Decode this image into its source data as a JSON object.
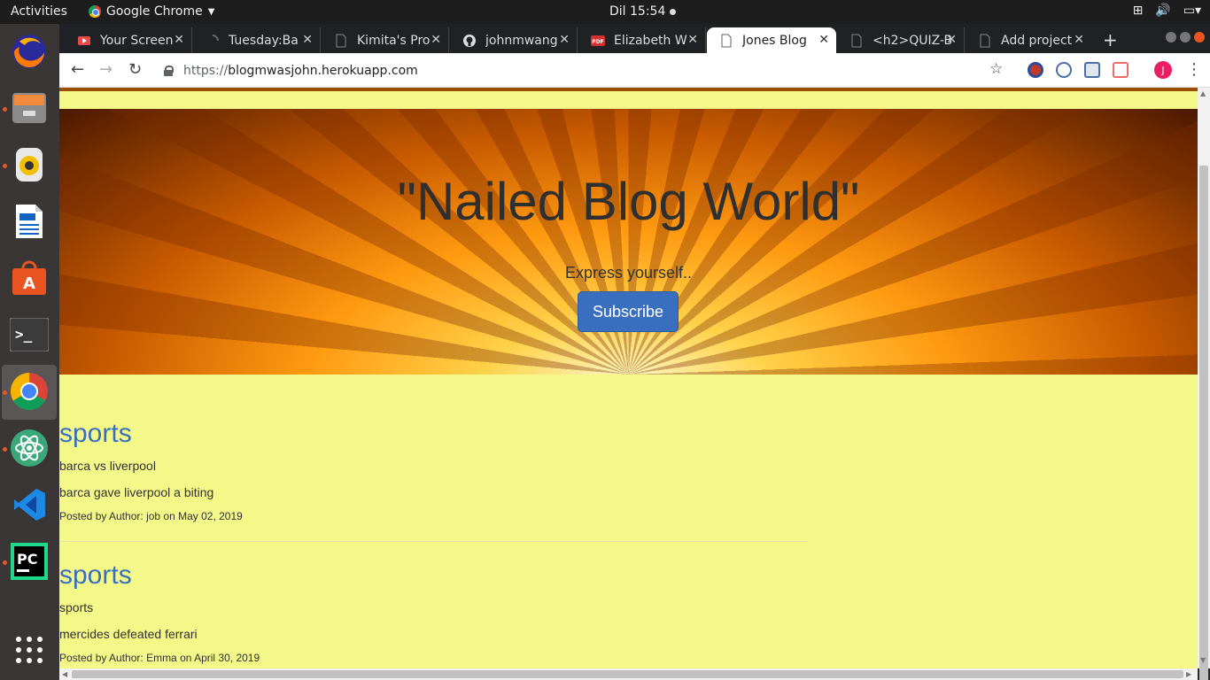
{
  "topbar": {
    "activities": "Activities",
    "app_name": "Google Chrome",
    "clock": "Dil 15:54"
  },
  "tabs": [
    {
      "title": "Your Screen",
      "favicon": "screencast-icon",
      "color": "#e94b4b"
    },
    {
      "title": "Tuesday:Ba",
      "favicon": "loading-icon",
      "color": "#666666"
    },
    {
      "title": "Kimita's Pro",
      "favicon": "document-icon",
      "color": "#888888"
    },
    {
      "title": "johnmwang",
      "favicon": "github-icon",
      "color": "#dddddd"
    },
    {
      "title": "Elizabeth W",
      "favicon": "pdf-icon",
      "color": "#d32f2f"
    },
    {
      "title": "Jones Blog",
      "favicon": "document-icon",
      "color": "#5f6368",
      "active": true
    },
    {
      "title": "<h2>QUIZ-B",
      "favicon": "document-icon",
      "color": "#888888"
    },
    {
      "title": "Add project",
      "favicon": "document-icon",
      "color": "#888888"
    }
  ],
  "address": {
    "scheme": "https://",
    "host": "blogmwasjohn.herokuapp.com"
  },
  "profile_initial": "J",
  "hero": {
    "title": "\"Nailed Blog World\"",
    "subtitle": "Express yourself..",
    "button": "Subscribe"
  },
  "posts": [
    {
      "category": "sports",
      "title": "barca vs liverpool",
      "body": "barca gave liverpool a biting",
      "meta": "Posted by Author: job on May 02, 2019"
    },
    {
      "category": "sports",
      "title": "sports",
      "body": "mercides defeated ferrari",
      "meta": "Posted by Author: Emma on April 30, 2019"
    }
  ],
  "colors": {
    "page_bg": "#f4f888",
    "link_blue": "#3a6fc0",
    "button_blue": "#3a6fc0",
    "topline": "#9b4e00"
  }
}
